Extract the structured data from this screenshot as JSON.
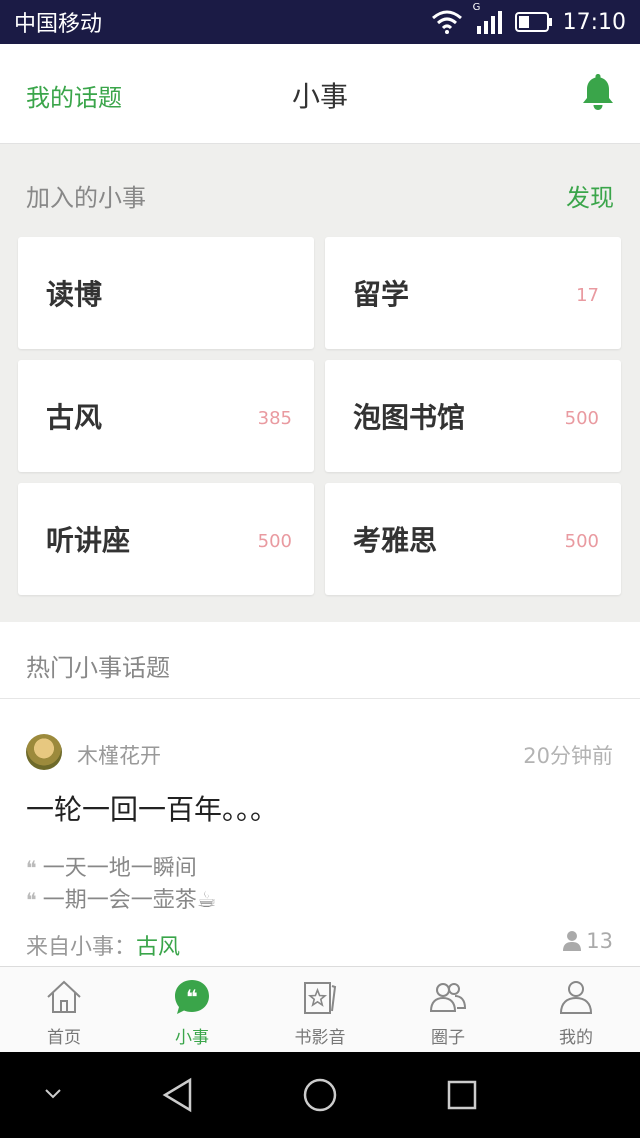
{
  "status_bar": {
    "carrier": "中国移动",
    "network": "G",
    "time": "17:10",
    "icons": [
      "wifi-icon",
      "signal-icon",
      "battery-icon"
    ]
  },
  "header": {
    "left_link": "我的话题",
    "title": "小事",
    "right_icon": "bell-icon"
  },
  "joined": {
    "title": "加入的小事",
    "discover": "发现",
    "cards": [
      {
        "name": "读博",
        "count": ""
      },
      {
        "name": "留学",
        "count": "17"
      },
      {
        "name": "古风",
        "count": "385"
      },
      {
        "name": "泡图书馆",
        "count": "500"
      },
      {
        "name": "听讲座",
        "count": "500"
      },
      {
        "name": "考雅思",
        "count": "500"
      }
    ]
  },
  "hot": {
    "title": "热门小事话题",
    "post": {
      "author": "木槿花开",
      "time": "20分钟前",
      "title": "一轮一回一百年。。。",
      "quotes": [
        "一天一地一瞬间",
        "一期一会一壶茶☕"
      ],
      "quote_mark": "❝",
      "from_label": "来自小事：",
      "from_link": "古风",
      "members": "13"
    }
  },
  "nav": {
    "items": [
      {
        "label": "首页",
        "icon": "home-icon",
        "active": false
      },
      {
        "label": "小事",
        "icon": "quote-bubble-icon",
        "active": true
      },
      {
        "label": "书影音",
        "icon": "book-film-music-icon",
        "active": false
      },
      {
        "label": "圈子",
        "icon": "group-icon",
        "active": false
      },
      {
        "label": "我的",
        "icon": "profile-icon",
        "active": false
      }
    ]
  },
  "colors": {
    "accent": "#3aa54a",
    "count": "#e99aa0",
    "status_bar": "#1b1b45"
  }
}
